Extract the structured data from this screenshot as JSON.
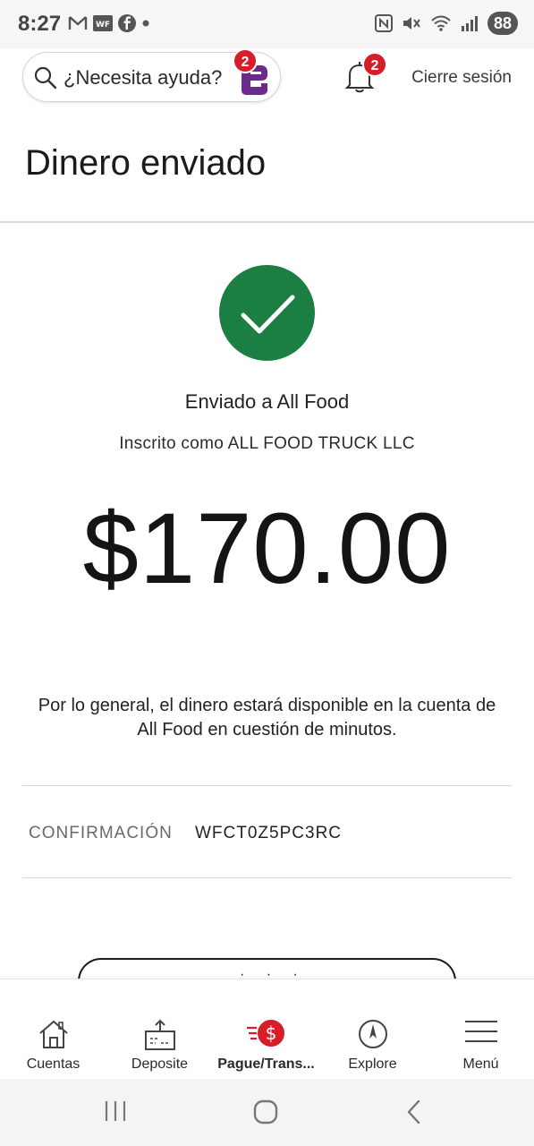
{
  "status_bar": {
    "time": "8:27",
    "battery": "88",
    "icons_left": [
      "gmail-icon",
      "wf-app-icon",
      "facebook-icon",
      "dot-icon"
    ],
    "icons_right": [
      "nfc-icon",
      "mute-icon",
      "wifi-icon",
      "signal-icon"
    ]
  },
  "header": {
    "search_placeholder": "¿Necesita ayuda?",
    "assistant_badge": "2",
    "notifications_badge": "2",
    "signout_label": "Cierre sesión"
  },
  "page": {
    "title": "Dinero enviado",
    "sent_to": "Enviado a All Food",
    "registered_as": "Inscrito como ALL FOOD TRUCK LLC",
    "amount": "$170.00",
    "note": "Por lo general, el dinero estará disponible en la cuenta de All Food en cuestión de minutos.",
    "confirmation_label": "CONFIRMACIÓN",
    "confirmation_value": "WFCT0Z5PC3RC"
  },
  "bottom_nav": {
    "items": [
      {
        "label": "Cuentas",
        "icon": "house-icon"
      },
      {
        "label": "Deposite",
        "icon": "deposit-icon"
      },
      {
        "label": "Pague/Trans...",
        "icon": "pay-transfer-icon",
        "active": true
      },
      {
        "label": "Explore",
        "icon": "compass-icon"
      },
      {
        "label": "Menú",
        "icon": "hamburger-menu-icon"
      }
    ]
  },
  "colors": {
    "success_green": "#1b7e43",
    "badge_red": "#d71e28",
    "assistant_purple": "#6b2a8c"
  }
}
